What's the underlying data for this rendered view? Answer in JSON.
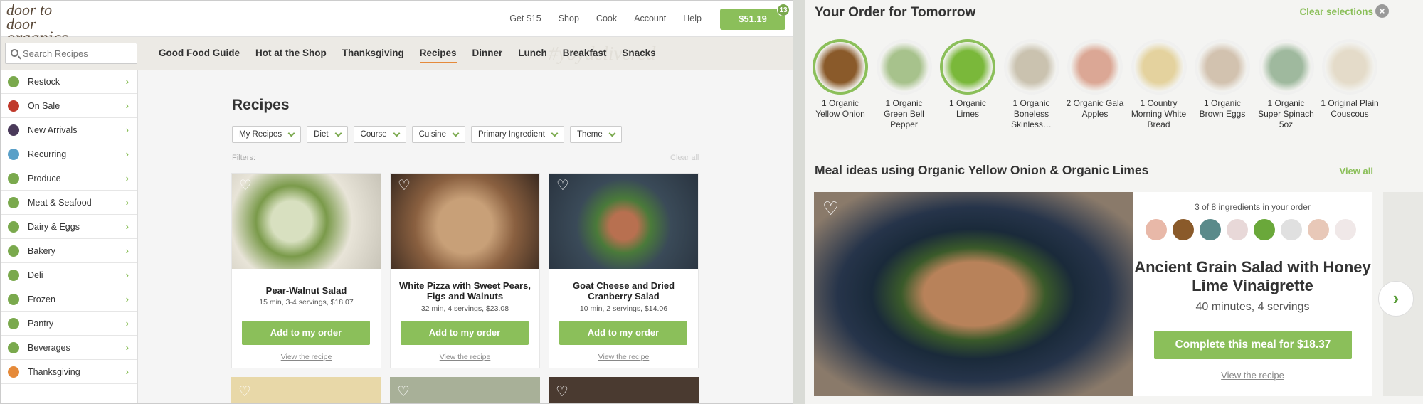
{
  "header": {
    "logo_line1": "door to door",
    "logo_line2": "organics",
    "nav": [
      "Get $15",
      "Shop",
      "Cook",
      "Account",
      "Help"
    ],
    "cart_total": "$51.19",
    "cart_count": "13"
  },
  "search": {
    "placeholder": "Search Recipes"
  },
  "catnav": [
    "Good Food Guide",
    "Hot at the Shop",
    "Thanksgiving",
    "Recipes",
    "Dinner",
    "Lunch",
    "Breakfast",
    "Snacks"
  ],
  "catnav_watermark": "#yoydelivered",
  "sidebar": [
    {
      "label": "Restock",
      "color": "#7aa94d"
    },
    {
      "label": "On Sale",
      "color": "#c0392b"
    },
    {
      "label": "New Arrivals",
      "color": "#4a3a5a"
    },
    {
      "label": "Recurring",
      "color": "#5aa0c8"
    },
    {
      "label": "Produce",
      "color": "#7aa94d"
    },
    {
      "label": "Meat & Seafood",
      "color": "#7aa94d"
    },
    {
      "label": "Dairy & Eggs",
      "color": "#7aa94d"
    },
    {
      "label": "Bakery",
      "color": "#7aa94d"
    },
    {
      "label": "Deli",
      "color": "#7aa94d"
    },
    {
      "label": "Frozen",
      "color": "#7aa94d"
    },
    {
      "label": "Pantry",
      "color": "#7aa94d"
    },
    {
      "label": "Beverages",
      "color": "#7aa94d"
    },
    {
      "label": "Thanksgiving",
      "color": "#e58a3a"
    }
  ],
  "recipes": {
    "title": "Recipes",
    "filters": [
      "My Recipes",
      "Diet",
      "Course",
      "Cuisine",
      "Primary Ingredient",
      "Theme"
    ],
    "filters_label": "Filters:",
    "clear_all": "Clear all",
    "cards": [
      {
        "title": "Pear-Walnut Salad",
        "meta": "15 min, 3-4 servings, $18.07",
        "button": "Add to my order",
        "view": "View the recipe"
      },
      {
        "title": "White Pizza with Sweet Pears, Figs and Walnuts",
        "meta": "32 min, 4 servings, $23.08",
        "button": "Add to my order",
        "view": "View the recipe"
      },
      {
        "title": "Goat Cheese and Dried Cranberry Salad",
        "meta": "10 min, 2 servings, $14.06",
        "button": "Add to my order",
        "view": "View the recipe"
      }
    ]
  },
  "order": {
    "title": "Your Order for Tomorrow",
    "clear": "Clear selections",
    "items": [
      {
        "label": "1 Organic Yellow Onion",
        "color": "#8a5a2a",
        "selected": true
      },
      {
        "label": "1 Organic Green Bell Pepper",
        "color": "#6a9a3a",
        "selected": false
      },
      {
        "label": "1 Organic Limes",
        "color": "#7ab83a",
        "selected": true
      },
      {
        "label": "1 Organic Boneless Skinless…",
        "color": "#a89a7a",
        "selected": false
      },
      {
        "label": "2 Organic Gala Apples",
        "color": "#c86a4a",
        "selected": false
      },
      {
        "label": "1 Country Morning White Bread",
        "color": "#d8b85a",
        "selected": false
      },
      {
        "label": "1 Organic Brown Eggs",
        "color": "#b89a7a",
        "selected": false
      },
      {
        "label": "1 Organic Super Spinach 5oz",
        "color": "#5a8a5a",
        "selected": false
      },
      {
        "label": "1 Original Plain Couscous",
        "color": "#d8c8a8",
        "selected": false
      }
    ]
  },
  "meal": {
    "heading": "Meal ideas using Organic Yellow Onion & Organic Limes",
    "view_all": "View all",
    "count": "3 of 8 ingredients in your order",
    "name": "Ancient Grain Salad with Honey Lime Vinaigrette",
    "meta": "40 minutes, 4 servings",
    "button": "Complete this meal for $18.37",
    "view": "View the recipe",
    "ingredient_colors": [
      "#e8b8a8",
      "#8a5a2a",
      "#5a8a8a",
      "#e8d8d8",
      "#6aa83a",
      "#e0e0e0",
      "#e8c8b8",
      "#f0e8e8"
    ]
  }
}
